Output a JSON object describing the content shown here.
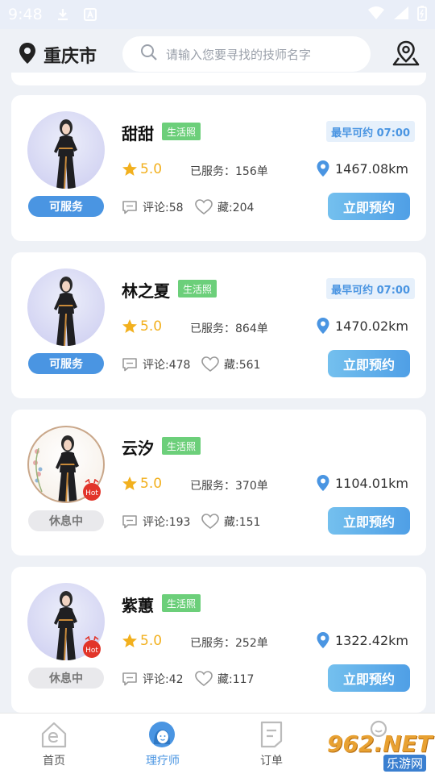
{
  "status_bar": {
    "time": "9:48"
  },
  "header": {
    "city": "重庆市",
    "search_placeholder": "请输入您要寻找的技师名字"
  },
  "technicians": [
    {
      "name": "甜甜",
      "tag": "生活照",
      "earliest": "最早可约 07:00",
      "rating": "5.0",
      "served": "已服务：156单",
      "distance": "1467.08km",
      "status": "可服务",
      "comments": "评论:58",
      "favorites": "藏:204",
      "book_label": "立即预约",
      "hot": false,
      "floral": false
    },
    {
      "name": "林之夏",
      "tag": "生活照",
      "earliest": "最早可约 07:00",
      "rating": "5.0",
      "served": "已服务：864单",
      "distance": "1470.02km",
      "status": "可服务",
      "comments": "评论:478",
      "favorites": "藏:561",
      "book_label": "立即预约",
      "hot": false,
      "floral": false
    },
    {
      "name": "云汐",
      "tag": "生活照",
      "earliest": "",
      "rating": "5.0",
      "served": "已服务：370单",
      "distance": "1104.01km",
      "status": "休息中",
      "comments": "评论:193",
      "favorites": "藏:151",
      "book_label": "立即预约",
      "hot": true,
      "floral": true
    },
    {
      "name": "紫蕙",
      "tag": "生活照",
      "earliest": "",
      "rating": "5.0",
      "served": "已服务：252单",
      "distance": "1322.42km",
      "status": "休息中",
      "comments": "评论:42",
      "favorites": "藏:117",
      "book_label": "立即预约",
      "hot": true,
      "floral": false
    }
  ],
  "hot_label": "Hot",
  "bottom_nav": {
    "home": "首页",
    "therapist": "理疗师",
    "orders": "订单"
  },
  "watermark": {
    "main": "962.NET",
    "sub": "乐游网"
  },
  "colors": {
    "accent": "#4a95e2",
    "tag": "#6ccf7a",
    "star": "#f2b01e"
  }
}
